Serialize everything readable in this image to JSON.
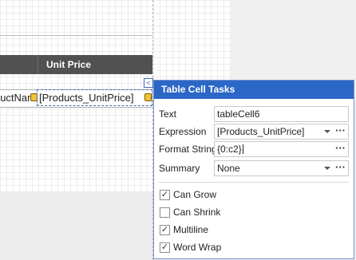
{
  "report": {
    "header_column_label": "Unit Price",
    "detail_left_text": "uctNam",
    "detail_selected_text": "[Products_UnitPrice]",
    "smart_tag_glyph": "<"
  },
  "panel": {
    "title": "Table Cell Tasks",
    "properties": [
      {
        "label": "Text",
        "value": "tableCell6",
        "kind": "text"
      },
      {
        "label": "Expression",
        "value": "[Products_UnitPrice]",
        "kind": "dropdown-ellipsis"
      },
      {
        "label": "Format String",
        "value": "{0:c2}",
        "kind": "text-ellipsis"
      },
      {
        "label": "Summary",
        "value": "None",
        "kind": "dropdown-ellipsis"
      }
    ],
    "ellipsis": "···",
    "checkboxes": [
      {
        "label": "Can Grow",
        "checked": true
      },
      {
        "label": "Can Shrink",
        "checked": false
      },
      {
        "label": "Multiline",
        "checked": true
      },
      {
        "label": "Word Wrap",
        "checked": true
      }
    ],
    "check_glyph": "✓"
  },
  "colors": {
    "title_bar": "#2b67c6",
    "header_row": "#515151",
    "selection_border": "#4a6fb5"
  }
}
